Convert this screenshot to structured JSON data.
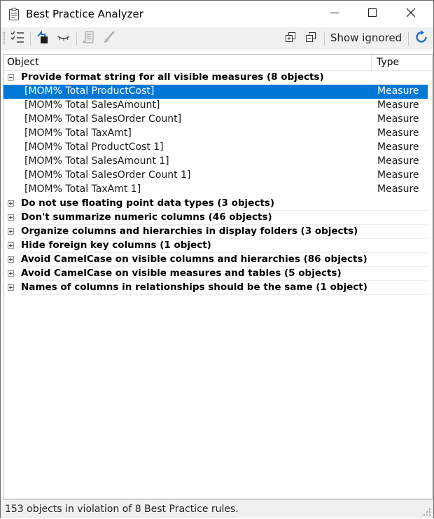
{
  "window": {
    "title": "Best Practice Analyzer"
  },
  "toolbar": {
    "show_ignored_label": "Show ignored",
    "icons": [
      "checklist-icon",
      "go-to-object-icon",
      "ignore-eye-icon",
      "script-icon",
      "fix-brush-icon",
      "expand-all-icon",
      "collapse-all-icon",
      "refresh-icon"
    ]
  },
  "columns": {
    "object": "Object",
    "type": "Type"
  },
  "groups": [
    {
      "label": "Provide format string for all visible measures (8 objects)",
      "expanded": true,
      "items": [
        {
          "name": "[MOM% Total ProductCost]",
          "type": "Measure",
          "selected": true
        },
        {
          "name": "[MOM% Total SalesAmount]",
          "type": "Measure"
        },
        {
          "name": "[MOM% Total SalesOrder Count]",
          "type": "Measure"
        },
        {
          "name": "[MOM% Total TaxAmt]",
          "type": "Measure"
        },
        {
          "name": "[MOM% Total ProductCost 1]",
          "type": "Measure"
        },
        {
          "name": "[MOM% Total SalesAmount 1]",
          "type": "Measure"
        },
        {
          "name": "[MOM% Total SalesOrder Count 1]",
          "type": "Measure"
        },
        {
          "name": "[MOM% Total TaxAmt 1]",
          "type": "Measure"
        }
      ]
    },
    {
      "label": "Do not use floating point data types (3 objects)",
      "expanded": false
    },
    {
      "label": "Don't summarize numeric columns (46 objects)",
      "expanded": false
    },
    {
      "label": "Organize columns and hierarchies in display folders (3 objects)",
      "expanded": false
    },
    {
      "label": "Hide foreign key columns (1 object)",
      "expanded": false
    },
    {
      "label": "Avoid CamelCase on visible columns and hierarchies (86 objects)",
      "expanded": false
    },
    {
      "label": "Avoid CamelCase on visible measures and tables (5 objects)",
      "expanded": false
    },
    {
      "label": "Names of columns in relationships should be the same (1 object)",
      "expanded": false
    }
  ],
  "status": {
    "text": "153 objects in violation of 8 Best Practice rules."
  },
  "colors": {
    "selection": "#0078d7",
    "refresh": "#1f6fd1"
  }
}
